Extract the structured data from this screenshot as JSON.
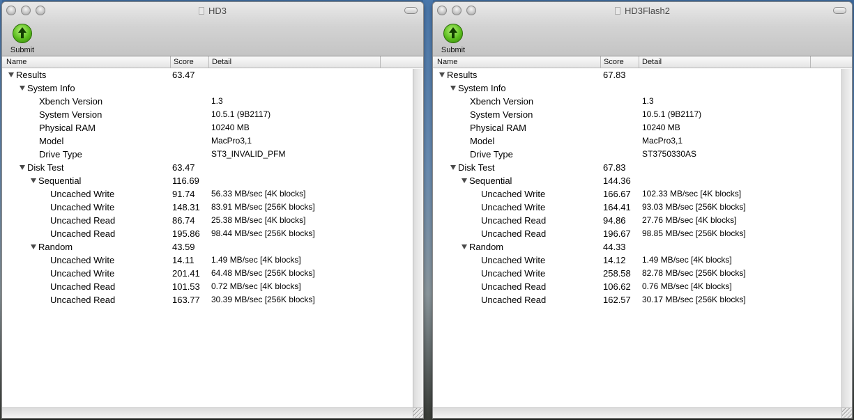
{
  "windows": [
    {
      "title": "HD3",
      "submit_label": "Submit",
      "columns": {
        "name": "Name",
        "score": "Score",
        "detail": "Detail"
      },
      "rows": [
        {
          "name": "Results",
          "score": "63.47",
          "detail": ""
        },
        {
          "name": "System Info",
          "score": "",
          "detail": ""
        },
        {
          "name": "Xbench Version",
          "score": "",
          "detail": "1.3"
        },
        {
          "name": "System Version",
          "score": "",
          "detail": "10.5.1 (9B2117)"
        },
        {
          "name": "Physical RAM",
          "score": "",
          "detail": "10240 MB"
        },
        {
          "name": "Model",
          "score": "",
          "detail": "MacPro3,1"
        },
        {
          "name": "Drive Type",
          "score": "",
          "detail": "ST3_INVALID_PFM"
        },
        {
          "name": "Disk Test",
          "score": "63.47",
          "detail": ""
        },
        {
          "name": "Sequential",
          "score": "116.69",
          "detail": ""
        },
        {
          "name": "Uncached Write",
          "score": "91.74",
          "detail": "56.33 MB/sec [4K blocks]"
        },
        {
          "name": "Uncached Write",
          "score": "148.31",
          "detail": "83.91 MB/sec [256K blocks]"
        },
        {
          "name": "Uncached Read",
          "score": "86.74",
          "detail": "25.38 MB/sec [4K blocks]"
        },
        {
          "name": "Uncached Read",
          "score": "195.86",
          "detail": "98.44 MB/sec [256K blocks]"
        },
        {
          "name": "Random",
          "score": "43.59",
          "detail": ""
        },
        {
          "name": "Uncached Write",
          "score": "14.11",
          "detail": "1.49 MB/sec [4K blocks]"
        },
        {
          "name": "Uncached Write",
          "score": "201.41",
          "detail": "64.48 MB/sec [256K blocks]"
        },
        {
          "name": "Uncached Read",
          "score": "101.53",
          "detail": "0.72 MB/sec [4K blocks]"
        },
        {
          "name": "Uncached Read",
          "score": "163.77",
          "detail": "30.39 MB/sec [256K blocks]"
        }
      ]
    },
    {
      "title": "HD3Flash2",
      "submit_label": "Submit",
      "columns": {
        "name": "Name",
        "score": "Score",
        "detail": "Detail"
      },
      "rows": [
        {
          "name": "Results",
          "score": "67.83",
          "detail": ""
        },
        {
          "name": "System Info",
          "score": "",
          "detail": ""
        },
        {
          "name": "Xbench Version",
          "score": "",
          "detail": "1.3"
        },
        {
          "name": "System Version",
          "score": "",
          "detail": "10.5.1 (9B2117)"
        },
        {
          "name": "Physical RAM",
          "score": "",
          "detail": "10240 MB"
        },
        {
          "name": "Model",
          "score": "",
          "detail": "MacPro3,1"
        },
        {
          "name": "Drive Type",
          "score": "",
          "detail": "ST3750330AS"
        },
        {
          "name": "Disk Test",
          "score": "67.83",
          "detail": ""
        },
        {
          "name": "Sequential",
          "score": "144.36",
          "detail": ""
        },
        {
          "name": "Uncached Write",
          "score": "166.67",
          "detail": "102.33 MB/sec [4K blocks]"
        },
        {
          "name": "Uncached Write",
          "score": "164.41",
          "detail": "93.03 MB/sec [256K blocks]"
        },
        {
          "name": "Uncached Read",
          "score": "94.86",
          "detail": "27.76 MB/sec [4K blocks]"
        },
        {
          "name": "Uncached Read",
          "score": "196.67",
          "detail": "98.85 MB/sec [256K blocks]"
        },
        {
          "name": "Random",
          "score": "44.33",
          "detail": ""
        },
        {
          "name": "Uncached Write",
          "score": "14.12",
          "detail": "1.49 MB/sec [4K blocks]"
        },
        {
          "name": "Uncached Write",
          "score": "258.58",
          "detail": "82.78 MB/sec [256K blocks]"
        },
        {
          "name": "Uncached Read",
          "score": "106.62",
          "detail": "0.76 MB/sec [4K blocks]"
        },
        {
          "name": "Uncached Read",
          "score": "162.57",
          "detail": "30.17 MB/sec [256K blocks]"
        }
      ]
    }
  ]
}
